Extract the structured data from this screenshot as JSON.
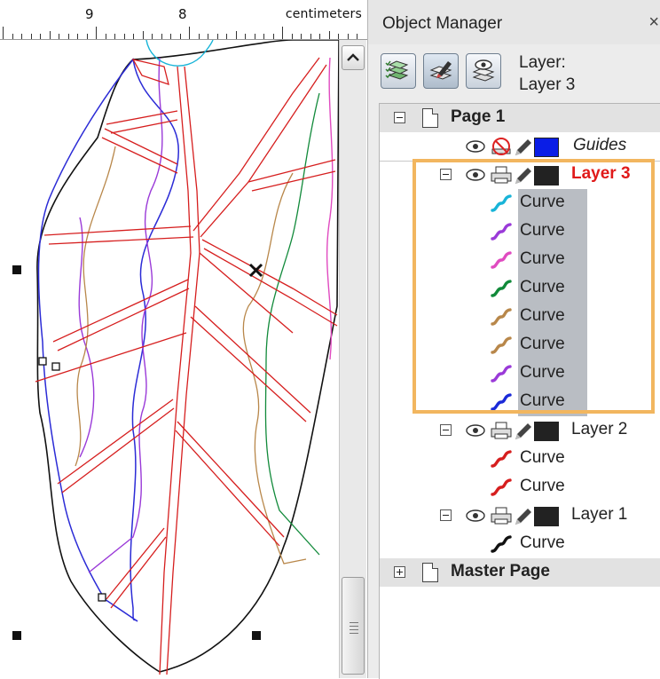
{
  "ruler": {
    "labels": [
      "9",
      "8"
    ],
    "unit": "centimeters"
  },
  "docker": {
    "title": "Object Manager",
    "close_glyph": "×",
    "toolbar": {
      "buttons": [
        {
          "icon": "show-object-properties-icon"
        },
        {
          "icon": "edit-across-layers-icon"
        },
        {
          "icon": "layer-manager-view-icon"
        }
      ],
      "layer_prefix": "Layer:",
      "active_layer": "Layer 3"
    },
    "tree": {
      "page1": {
        "label": "Page 1"
      },
      "guides": {
        "label": "Guides",
        "color": "#0a1de6"
      },
      "layer3": {
        "label": "Layer 3",
        "label_color": "#e01a1a",
        "color": "#222222",
        "curves": [
          {
            "label": "Curve",
            "color": "#18b4d8"
          },
          {
            "label": "Curve",
            "color": "#9a3ad8"
          },
          {
            "label": "Curve",
            "color": "#e04bc0"
          },
          {
            "label": "Curve",
            "color": "#118a3a"
          },
          {
            "label": "Curve",
            "color": "#b8874a"
          },
          {
            "label": "Curve",
            "color": "#b8874a"
          },
          {
            "label": "Curve",
            "color": "#9a3ad8"
          },
          {
            "label": "Curve",
            "color": "#1a2ad8"
          }
        ]
      },
      "layer2": {
        "label": "Layer 2",
        "color": "#222222",
        "curves": [
          {
            "label": "Curve",
            "color": "#d61e1e"
          },
          {
            "label": "Curve",
            "color": "#d61e1e"
          }
        ]
      },
      "layer1": {
        "label": "Layer 1",
        "color": "#222222",
        "curves": [
          {
            "label": "Curve",
            "color": "#111111"
          }
        ]
      },
      "master": {
        "label": "Master Page"
      }
    }
  },
  "colors": {
    "highlight_border": "#f2b65f",
    "curve_highlight": "#b9bdc3"
  }
}
